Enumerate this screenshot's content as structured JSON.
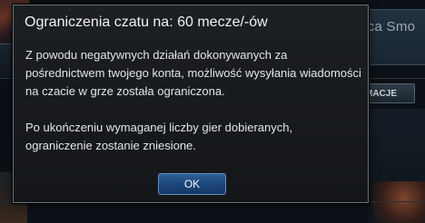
{
  "background": {
    "right_partial_text": "nca Smo",
    "right_partial_button": "MACJE"
  },
  "dialog": {
    "title": "Ograniczenia czatu na: 60 mecze/-ów",
    "paragraph1": "Z powodu negatywnych działań dokonywanych za pośrednictwem twojego konta, możliwość wysyłania wiadomości na czacie w grze została ograniczona.",
    "paragraph2": "Po ukończeniu wymaganej liczby gier dobieranych, ograniczenie zostanie zniesione.",
    "ok_label": "OK"
  }
}
